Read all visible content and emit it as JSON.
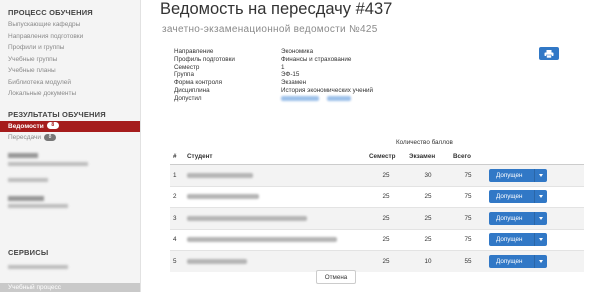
{
  "sidebar": {
    "process_title": "ПРОЦЕСС ОБУЧЕНИЯ",
    "process_items": [
      {
        "label": "Выпускающие кафедры"
      },
      {
        "label": "Направления подготовки"
      },
      {
        "label": "Профили и группы"
      },
      {
        "label": "Учебные группы"
      },
      {
        "label": "Учебные планы"
      },
      {
        "label": "Библиотека модулей"
      },
      {
        "label": "Локальные документы"
      }
    ],
    "results_title": "РЕЗУЛЬТАТЫ ОБУЧЕНИЯ",
    "results_items": [
      {
        "label": "Ведомости",
        "badge": "8",
        "active": true
      },
      {
        "label": "Пересдачи",
        "badge": "8",
        "active": false
      }
    ],
    "services_title": "СЕРВИСЫ",
    "bottom_label": "Учебный процесс"
  },
  "header": {
    "title": "Ведомость на пересдачу #437",
    "subtitle": "зачетно-экзаменационной ведомости №425"
  },
  "print_button": {
    "icon": "print-icon"
  },
  "info": [
    {
      "key": "Направление",
      "value": "Экономика"
    },
    {
      "key": "Профиль подготовки",
      "value": "Финансы и страхование"
    },
    {
      "key": "Семестр",
      "value": "1"
    },
    {
      "key": "Группа",
      "value": "ЭФ-15"
    },
    {
      "key": "Форма контроля",
      "value": "Экзамен"
    },
    {
      "key": "Дисциплина",
      "value": "История экономических учений"
    },
    {
      "key": "Допустил",
      "value": ""
    }
  ],
  "table": {
    "group_header": "Количество баллов",
    "columns": {
      "num": "#",
      "student": "Студент",
      "semester": "Семестр",
      "exam": "Экзамен",
      "total": "Всего"
    },
    "rows": [
      {
        "num": "1",
        "semester": "25",
        "exam": "30",
        "total": "75",
        "action": "Допущен"
      },
      {
        "num": "2",
        "semester": "25",
        "exam": "25",
        "total": "75",
        "action": "Допущен"
      },
      {
        "num": "3",
        "semester": "25",
        "exam": "25",
        "total": "75",
        "action": "Допущен"
      },
      {
        "num": "4",
        "semester": "25",
        "exam": "25",
        "total": "75",
        "action": "Допущен"
      },
      {
        "num": "5",
        "semester": "25",
        "exam": "10",
        "total": "55",
        "action": "Допущен"
      }
    ]
  },
  "cancel_label": "Отмена",
  "colors": {
    "accent": "#a51c1c",
    "primary": "#3178c6"
  }
}
